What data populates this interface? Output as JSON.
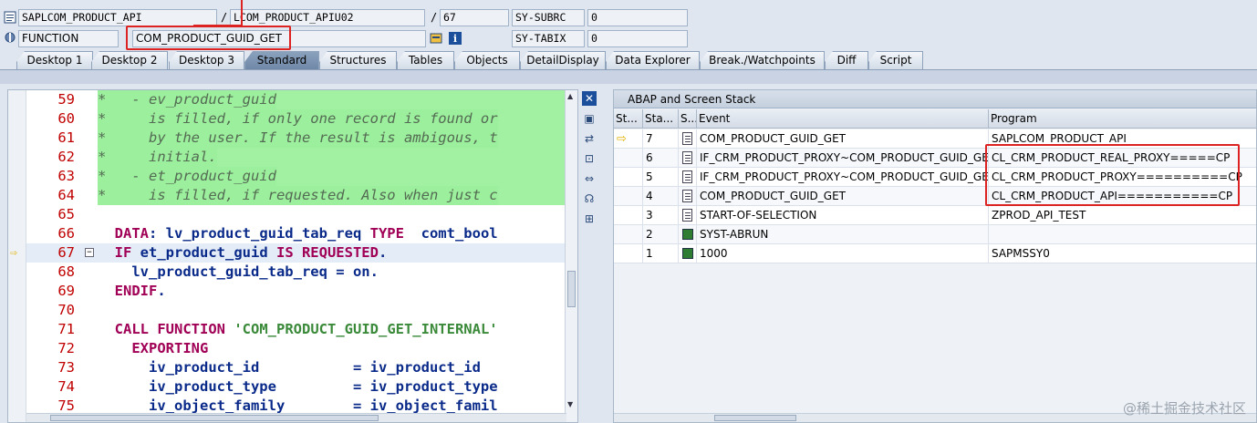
{
  "header": {
    "program": "SAPLCOM_PRODUCT_API",
    "include": "LCOM_PRODUCT_APIU02",
    "line": "67",
    "sy_subrc_label": "SY-SUBRC",
    "sy_subrc_value": "0",
    "block_type": "FUNCTION",
    "block_name": "COM_PRODUCT_GUID_GET",
    "sy_tabix_label": "SY-TABIX",
    "sy_tabix_value": "0",
    "sep1": "/",
    "sep2": "/"
  },
  "tabs": [
    {
      "label": "Desktop 1"
    },
    {
      "label": "Desktop 2"
    },
    {
      "label": "Desktop 3"
    },
    {
      "label": "Standard",
      "active": true
    },
    {
      "label": "Structures"
    },
    {
      "label": "Tables"
    },
    {
      "label": "Objects"
    },
    {
      "label": "DetailDisplay"
    },
    {
      "label": "Data Explorer"
    },
    {
      "label": "Break./Watchpoints"
    },
    {
      "label": "Diff"
    },
    {
      "label": "Script"
    }
  ],
  "source": {
    "lines": [
      {
        "n": "59",
        "text": "*   - ev_product_guid",
        "type": "comment"
      },
      {
        "n": "60",
        "text": "*     is filled, if only one record is found or",
        "type": "comment"
      },
      {
        "n": "61",
        "text": "*     by the user. If the result is ambigous, t",
        "type": "comment"
      },
      {
        "n": "62",
        "text": "*     initial.",
        "type": "comment"
      },
      {
        "n": "63",
        "text": "*   - et_product_guid",
        "type": "comment"
      },
      {
        "n": "64",
        "text": "*     is filled, if requested. Also when just c",
        "type": "comment"
      },
      {
        "n": "65",
        "text": "",
        "type": "plain"
      },
      {
        "n": "66",
        "text": "  DATA: lv_product_guid_tab_req TYPE  comt_bool",
        "type": "data"
      },
      {
        "n": "67",
        "text": "  IF et_product_guid IS REQUESTED.",
        "type": "if",
        "current": true
      },
      {
        "n": "68",
        "text": "    lv_product_guid_tab_req = on.",
        "type": "assign"
      },
      {
        "n": "69",
        "text": "  ENDIF.",
        "type": "endif"
      },
      {
        "n": "70",
        "text": "",
        "type": "plain"
      },
      {
        "n": "71",
        "text": "  CALL FUNCTION 'COM_PRODUCT_GUID_GET_INTERNAL'",
        "type": "call"
      },
      {
        "n": "72",
        "text": "    EXPORTING",
        "type": "exporting"
      },
      {
        "n": "73",
        "text": "      iv_product_id           = iv_product_id",
        "type": "param"
      },
      {
        "n": "74",
        "text": "      iv_product_type         = iv_product_type",
        "type": "param"
      },
      {
        "n": "75",
        "text": "      iv_object_family        = iv_object_famil",
        "type": "param"
      }
    ]
  },
  "stack": {
    "title": "ABAP and Screen Stack",
    "columns": [
      "St...",
      "Sta...",
      "S...",
      "Event",
      "Program"
    ],
    "rows": [
      {
        "level": "7",
        "type": "doc",
        "event": "COM_PRODUCT_GUID_GET",
        "program": "SAPLCOM_PRODUCT_API",
        "current": true
      },
      {
        "level": "6",
        "type": "doc",
        "event": "IF_CRM_PRODUCT_PROXY~COM_PRODUCT_GUID_GET",
        "program": "CL_CRM_PRODUCT_REAL_PROXY=====CP"
      },
      {
        "level": "5",
        "type": "doc",
        "event": "IF_CRM_PRODUCT_PROXY~COM_PRODUCT_GUID_GET",
        "program": "CL_CRM_PRODUCT_PROXY==========CP"
      },
      {
        "level": "4",
        "type": "doc",
        "event": "COM_PRODUCT_GUID_GET",
        "program": "CL_CRM_PRODUCT_API===========CP"
      },
      {
        "level": "3",
        "type": "doc",
        "event": "START-OF-SELECTION",
        "program": "ZPROD_API_TEST"
      },
      {
        "level": "2",
        "type": "screen",
        "event": "SYST-ABRUN",
        "program": ""
      },
      {
        "level": "1",
        "type": "screen",
        "event": "1000",
        "program": "SAPMSSY0"
      }
    ]
  },
  "watermark": "@稀土掘金技术社区",
  "colors": {
    "highlight_red": "#dd2222",
    "comment_bg": "#a2f0a2",
    "keyword": "#a00055",
    "line_number": "#c00000"
  }
}
